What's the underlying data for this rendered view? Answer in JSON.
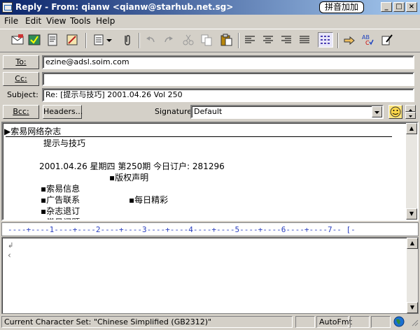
{
  "window": {
    "title": "Reply - From: qianw <qianw@starhub.net.sg>",
    "ime_label": "拼音加加",
    "minimize": "_",
    "maximize": "□",
    "close": "×"
  },
  "menu": [
    "File",
    "Edit",
    "View",
    "Tools",
    "Help"
  ],
  "toolbar": {
    "icons": [
      "send-icon",
      "check-names-icon",
      "address-book-icon",
      "notepad-icon",
      "insert-file-icon",
      "attach-icon",
      "undo-icon",
      "redo-icon",
      "cut-icon",
      "copy-icon",
      "paste-icon",
      "align-left-icon",
      "align-center-icon",
      "align-right-icon",
      "table-icon",
      "bookmark-icon",
      "spell-check-icon",
      "edit-signature-icon"
    ]
  },
  "header": {
    "to_label": "To:",
    "to_value": "ezine@adsl.soim.com",
    "cc_label": "Cc:",
    "cc_value": "",
    "subject_label": "Subject:",
    "subject_value": "Re: [提示与技巧] 2001.04.26 Vol 250",
    "bcc_label": "Bcc:",
    "headers_label": "Headers...",
    "signature_label": "Signature:",
    "signature_value": "Default"
  },
  "body": {
    "lines": [
      "▶索易网络杂志",
      "提示与技巧",
      "2001.04.26 星期四 第250期 今日订户: 281296",
      "▪版权声明",
      "▪索易信息",
      "▪广告联系",
      "▪每日精彩",
      "▪杂志退订",
      "▪常见问题"
    ]
  },
  "ruler": "----+----1----+----2----+----3----+----4----+----5----+----6----+----7-- [-",
  "editor": {
    "marks": [
      "↲",
      "‹"
    ]
  },
  "status": {
    "charset": "Current Character Set: \"Chinese Simplified (GB2312)\"",
    "autofmt": "AutoFmt"
  }
}
